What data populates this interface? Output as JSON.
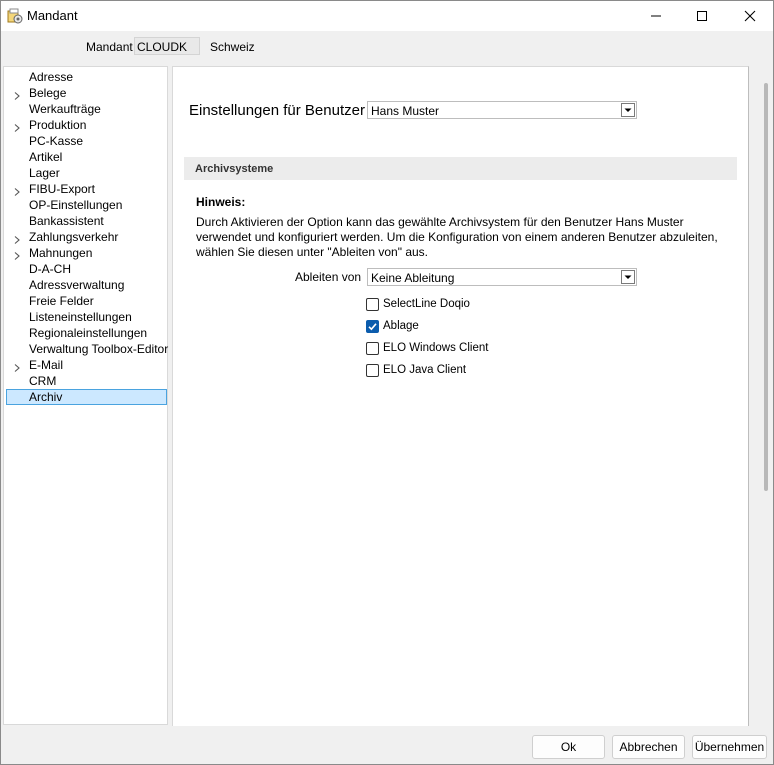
{
  "window": {
    "title": "Mandant"
  },
  "header": {
    "mandant_label": "Mandant",
    "mandant_value": "CLOUDK",
    "mandant_description": "Schweiz"
  },
  "tree": {
    "items": [
      {
        "label": "Adresse",
        "expandable": false
      },
      {
        "label": "Belege",
        "expandable": true
      },
      {
        "label": "Werkaufträge",
        "expandable": false
      },
      {
        "label": "Produktion",
        "expandable": true
      },
      {
        "label": "PC-Kasse",
        "expandable": false
      },
      {
        "label": "Artikel",
        "expandable": false
      },
      {
        "label": "Lager",
        "expandable": false
      },
      {
        "label": "FIBU-Export",
        "expandable": true
      },
      {
        "label": "OP-Einstellungen",
        "expandable": false
      },
      {
        "label": "Bankassistent",
        "expandable": false
      },
      {
        "label": "Zahlungsverkehr",
        "expandable": true
      },
      {
        "label": "Mahnungen",
        "expandable": true
      },
      {
        "label": "D-A-CH",
        "expandable": false
      },
      {
        "label": "Adressverwaltung",
        "expandable": false
      },
      {
        "label": "Freie Felder",
        "expandable": false
      },
      {
        "label": "Listeneinstellungen",
        "expandable": false
      },
      {
        "label": "Regionaleinstellungen",
        "expandable": false
      },
      {
        "label": "Verwaltung Toolbox-Editor",
        "expandable": false
      },
      {
        "label": "E-Mail",
        "expandable": true
      },
      {
        "label": "CRM",
        "expandable": false
      },
      {
        "label": "Archiv",
        "expandable": false,
        "selected": true
      }
    ]
  },
  "main": {
    "user_settings_label": "Einstellungen für Benutzer",
    "user_value": "Hans Muster",
    "section_title": "Archivsysteme",
    "hint_title": "Hinweis:",
    "hint_text": "Durch Aktivieren der Option kann das gewählte Archivsystem für den Benutzer Hans Muster verwendet und konfiguriert werden. Um die Konfiguration von einem anderen Benutzer abzuleiten, wählen Sie diesen unter \"Ableiten von\" aus.",
    "ableiten_label": "Ableiten von",
    "ableiten_value": "Keine Ableitung",
    "options": [
      {
        "label": "SelectLine Doqio",
        "checked": false
      },
      {
        "label": "Ablage",
        "checked": true
      },
      {
        "label": "ELO Windows Client",
        "checked": false
      },
      {
        "label": "ELO Java Client",
        "checked": false
      }
    ]
  },
  "footer": {
    "ok_label": "Ok",
    "cancel_label": "Abbrechen",
    "apply_label": "Übernehmen"
  },
  "colors": {
    "selection_bg": "#cce8ff",
    "selection_border": "#4aa3df",
    "checkbox_checked": "#0b5cad"
  }
}
